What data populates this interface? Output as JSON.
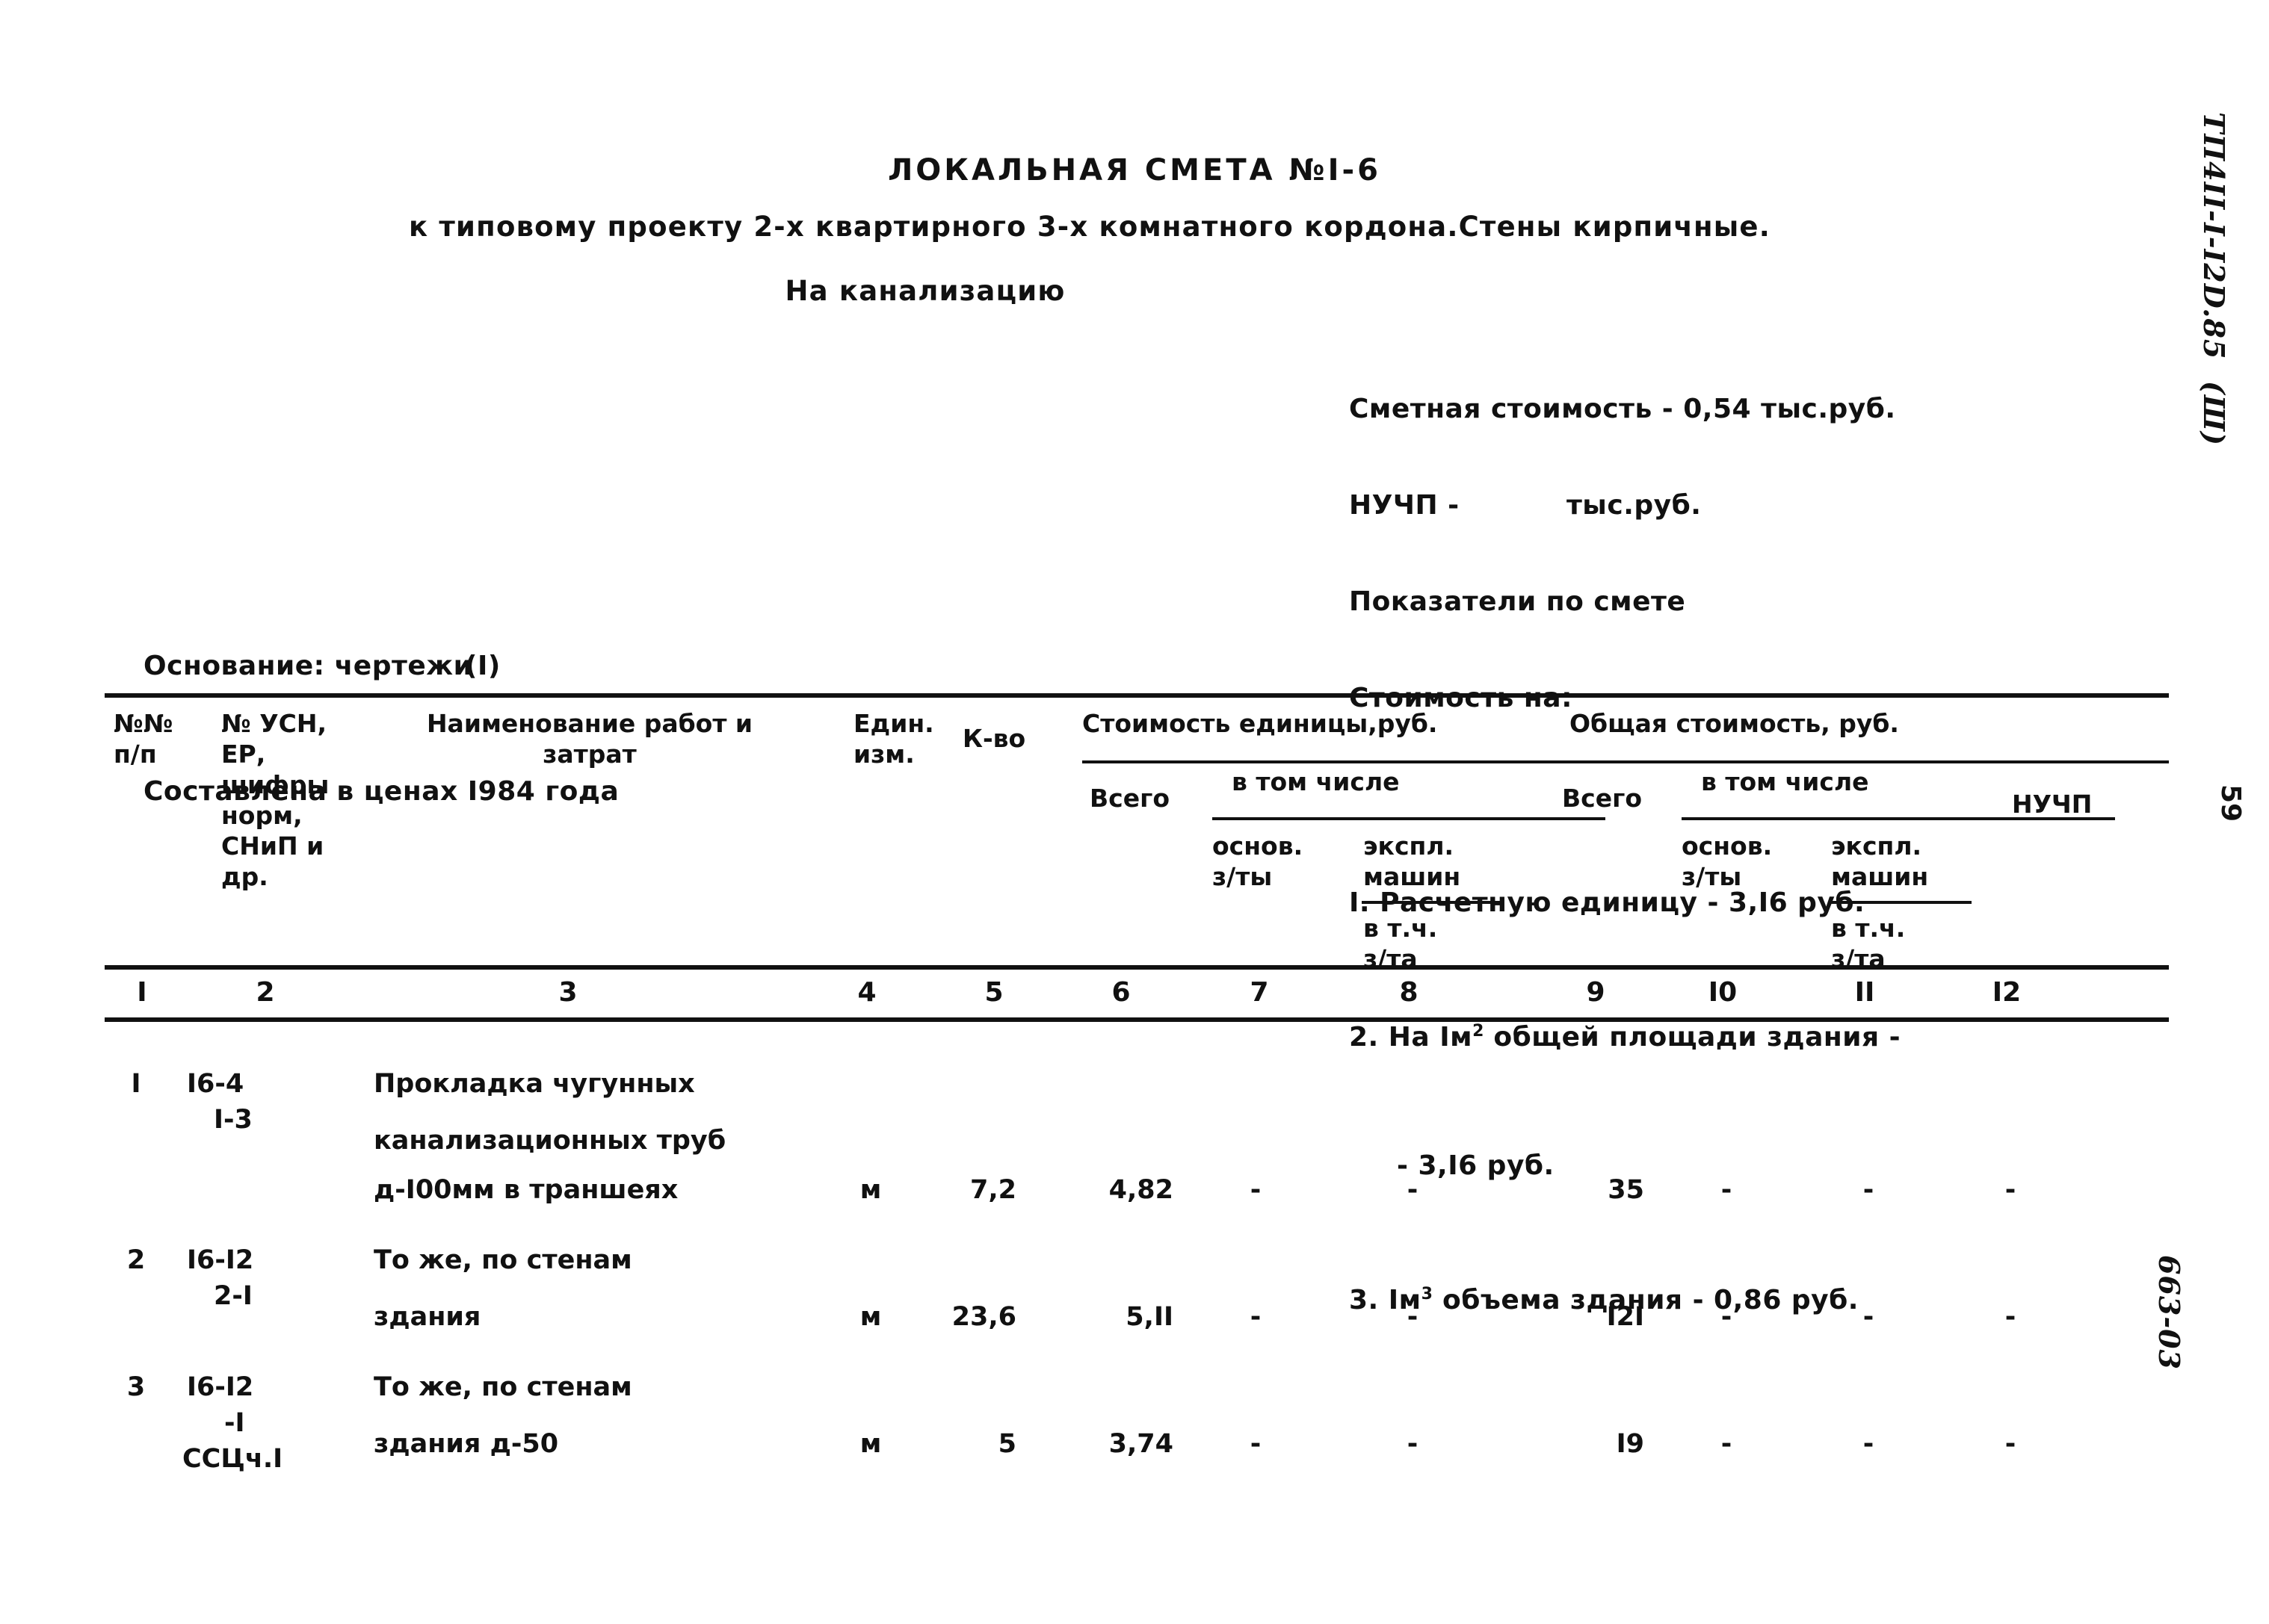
{
  "document": {
    "title": "ЛОКАЛЬНАЯ СМЕТА №I-6",
    "subtitle": "к типовому проекту 2-х квартирного 3-х комнатного кордона.Стены кирпичные.",
    "subject": "На канализацию"
  },
  "summary": {
    "estimate_cost": "Сметная стоимость - 0,54 тыс.руб.",
    "nuchp": "НУЧП -           тыс.руб.",
    "indicators_header": "Показатели по смете",
    "cost_on_header": "Стоимость на:",
    "items": [
      {
        "num": "I.",
        "text_before": "Расчетную единицу - 3,I6 руб.",
        "sup": "",
        "text_after": ""
      },
      {
        "num": "2.",
        "text_before": "На Iм",
        "sup": "2",
        "text_after": " общей площади здания -"
      },
      {
        "num": "",
        "text_before": "- 3,I6 руб.",
        "sup": "",
        "text_after": ""
      },
      {
        "num": "3.",
        "text_before": "Iм",
        "sup": "3",
        "text_after": " объема здания - 0,86 руб."
      }
    ]
  },
  "basis": {
    "line1": "Основание: чертежи",
    "line1_note": "(I)",
    "line2": "Составлена в ценах I984 года"
  },
  "table": {
    "headers": {
      "col1": "№№\nп/п",
      "col2": "№ УСН,\nЕР,\nшифры\nнорм,\nСНиП и\nдр.",
      "col3": "Наименование работ и",
      "col3b": "затрат",
      "col4": "Един.\nизм.",
      "col5": "К-во",
      "group_unit_cost": "Стоимость единицы,руб.",
      "group_total_cost": "Общая стоимость, руб.",
      "vsego_left": "Всего",
      "vsego_right": "Всего",
      "vtom_left": "в том числе",
      "vtom_right": "в том числе",
      "osnov_left": "основ.\nз/ты",
      "ekspl_left": "экспл.\nмашин",
      "vtch_left": "в т.ч.\nз/та",
      "osnov_right": "основ.\nз/ты",
      "ekspl_right": "экспл.\nмашин",
      "vtch_right": "в т.ч.\nз/та",
      "nuchp": "НУЧП"
    },
    "column_numbers": [
      "I",
      "2",
      "3",
      "4",
      "5",
      "6",
      "7",
      "8",
      "9",
      "I0",
      "II",
      "I2"
    ],
    "rows": [
      {
        "no": "I",
        "code_main": "I6-4",
        "code_sub": "I-3",
        "code_sub2": "",
        "name_lines": [
          "Прокладка чугунных",
          "канализационных труб",
          "д-I00мм в траншеях"
        ],
        "unit": "м",
        "qty": "7,2",
        "unit_total": "4,82",
        "unit_osnov": "-",
        "unit_ekspl": "-",
        "total": "35",
        "total_osnov": "-",
        "total_ekspl": "-",
        "nuchp": "-"
      },
      {
        "no": "2",
        "code_main": "I6-I2",
        "code_sub": "2-I",
        "code_sub2": "",
        "name_lines": [
          "То же, по стенам",
          "здания"
        ],
        "unit": "м",
        "qty": "23,6",
        "unit_total": "5,II",
        "unit_osnov": "-",
        "unit_ekspl": "-",
        "total": "I2I",
        "total_osnov": "-",
        "total_ekspl": "-",
        "nuchp": "-"
      },
      {
        "no": "3",
        "code_main": "I6-I2",
        "code_sub": "-I",
        "code_sub2": "ССЦч.I",
        "name_lines": [
          "То же, по стенам",
          "здания д-50"
        ],
        "unit": "м",
        "qty": "5",
        "unit_total": "3,74",
        "unit_osnov": "-",
        "unit_ekspl": "-",
        "total": "I9",
        "total_osnov": "-",
        "total_ekspl": "-",
        "nuchp": "-"
      }
    ]
  },
  "margin": {
    "project_code": "ТП4II-I-I2D.85  (Ш)",
    "page_number": "59",
    "sheet_code": "663-03"
  }
}
